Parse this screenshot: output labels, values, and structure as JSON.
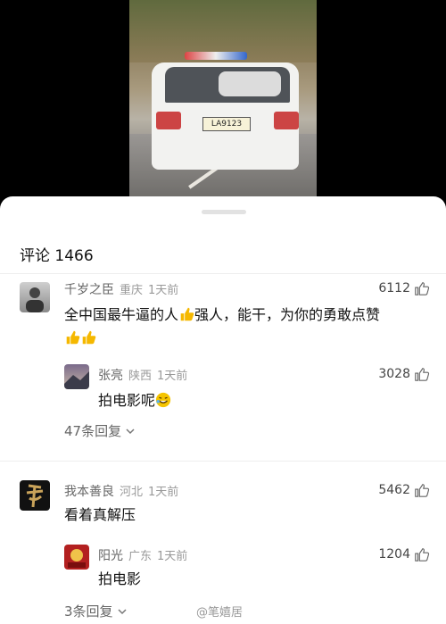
{
  "video": {
    "plate_text": "LA9123"
  },
  "comments_header": {
    "label": "评论",
    "count": "1466"
  },
  "comments": [
    {
      "user": "千岁之臣",
      "location": "重庆",
      "time": "1天前",
      "likes": "6112",
      "text": "全中国最牛逼的人",
      "text2": "强人，能干，为你的勇敢点赞",
      "reply": {
        "user": "张亮",
        "location": "陕西",
        "time": "1天前",
        "likes": "3028",
        "text": "拍电影呢"
      },
      "more_replies": "47条回复"
    },
    {
      "user": "我本善良",
      "location": "河北",
      "time": "1天前",
      "likes": "5462",
      "text": "看着真解压",
      "reply": {
        "user": "阳光",
        "location": "广东",
        "time": "1天前",
        "likes": "1204",
        "text": "拍电影"
      },
      "more_replies": "3条回复"
    }
  ],
  "watermark": "@笔嬉居"
}
